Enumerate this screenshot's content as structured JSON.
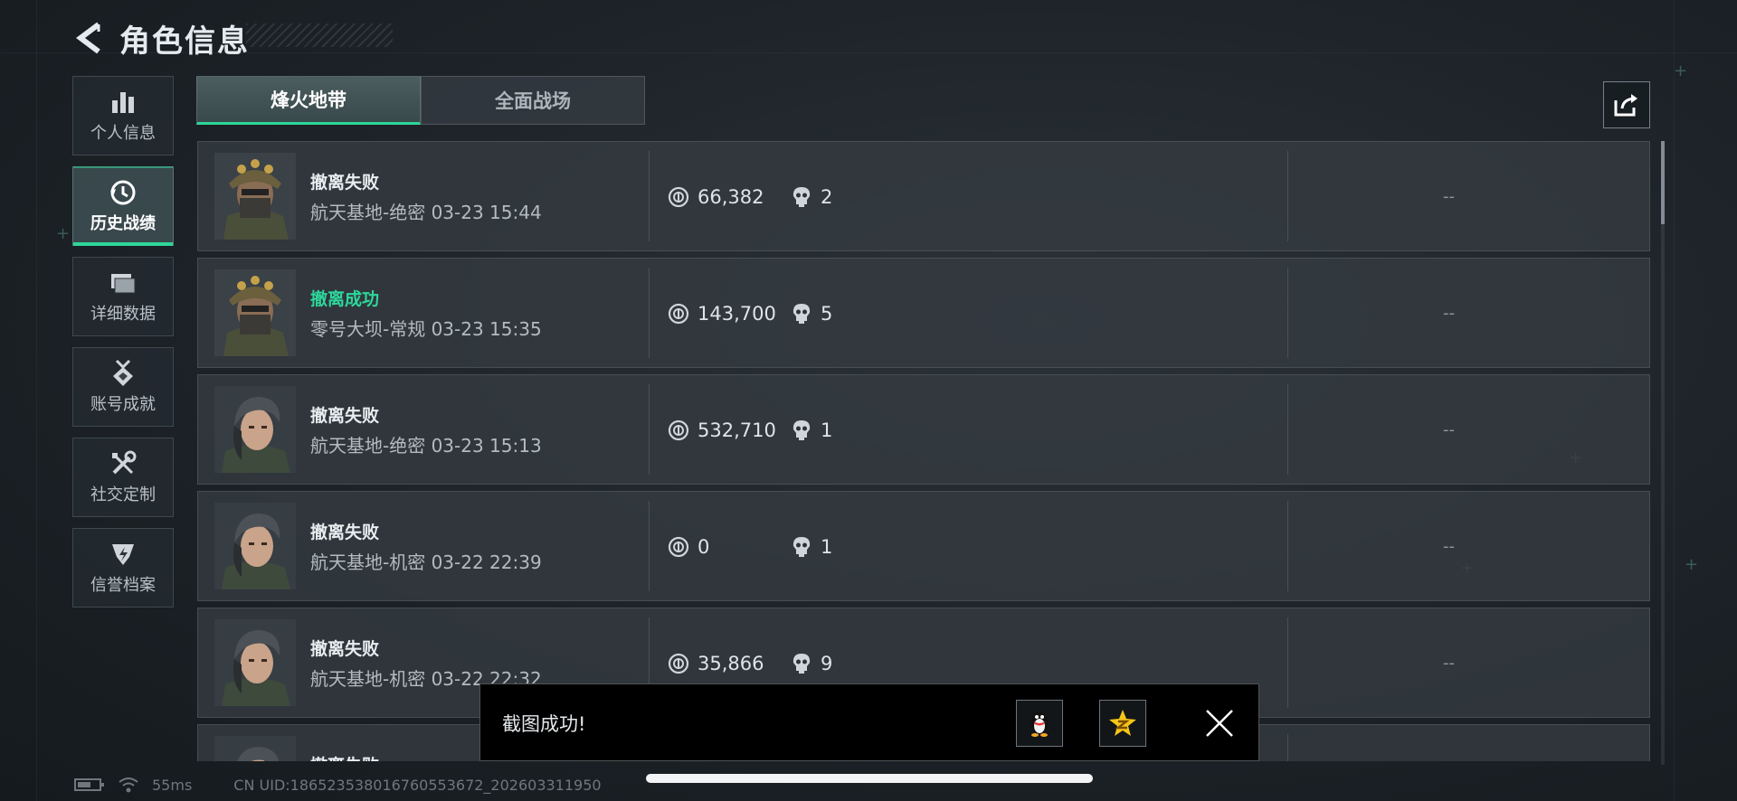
{
  "header": {
    "title": "角色信息"
  },
  "sidebar": {
    "items": [
      {
        "label": "个人信息",
        "icon": "bar-chart-icon"
      },
      {
        "label": "历史战绩",
        "icon": "history-clock-icon"
      },
      {
        "label": "详细数据",
        "icon": "folder-icon"
      },
      {
        "label": "账号成就",
        "icon": "medal-icon"
      },
      {
        "label": "社交定制",
        "icon": "tools-icon"
      },
      {
        "label": "信誉档案",
        "icon": "shield-badge-icon"
      }
    ],
    "active_index": 1
  },
  "tabs": [
    {
      "label": "烽火地带"
    },
    {
      "label": "全面战场"
    }
  ],
  "share_icon": "share-icon",
  "records": [
    {
      "status": "撤离失败",
      "success": false,
      "map": "航天基地-绝密",
      "time": "03-23 15:44",
      "value": "66,382",
      "kills": "2",
      "extra": "--",
      "avatar": "helmet-operator"
    },
    {
      "status": "撤离成功",
      "success": true,
      "map": "零号大坝-常规",
      "time": "03-23 15:35",
      "value": "143,700",
      "kills": "5",
      "extra": "--",
      "avatar": "helmet-operator"
    },
    {
      "status": "撤离失败",
      "success": false,
      "map": "航天基地-绝密",
      "time": "03-23 15:13",
      "value": "532,710",
      "kills": "1",
      "extra": "--",
      "avatar": "female-operator"
    },
    {
      "status": "撤离失败",
      "success": false,
      "map": "航天基地-机密",
      "time": "03-22 22:39",
      "value": "0",
      "kills": "1",
      "extra": "--",
      "avatar": "female-operator"
    },
    {
      "status": "撤离失败",
      "success": false,
      "map": "航天基地-机密",
      "time": "03-22 22:32",
      "value": "35,866",
      "kills": "9",
      "extra": "--",
      "avatar": "female-operator"
    },
    {
      "status": "撤离失败",
      "success": false,
      "map": "",
      "time": "",
      "value": "",
      "kills": "",
      "extra": "",
      "avatar": "female-operator"
    }
  ],
  "toast": {
    "message": "截图成功!",
    "qq_icon": "qq-penguin-icon",
    "qzone_icon": "qzone-star-icon"
  },
  "footer": {
    "ping": "55ms",
    "uid": "CN UID:18652353801676055367​2_202603311950"
  },
  "colors": {
    "accent": "#2ed69a",
    "success_text": "#2ed69a"
  }
}
